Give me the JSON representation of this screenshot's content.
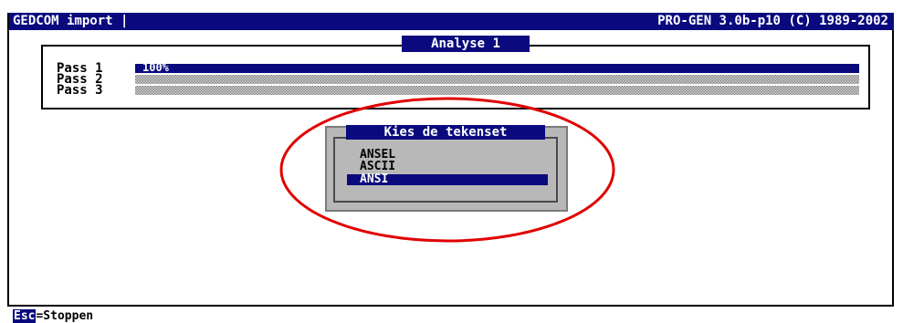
{
  "titlebar": {
    "left": "GEDCOM import |",
    "right": "PRO-GEN 3.0b-p10 (C) 1989-2002"
  },
  "analyse": {
    "title": "Analyse 1",
    "passes": [
      {
        "label": "Pass 1",
        "progress": 1.0,
        "progress_text": "100%"
      },
      {
        "label": "Pass 2",
        "progress": 0
      },
      {
        "label": "Pass 3",
        "progress": 0
      }
    ]
  },
  "dialog": {
    "title": "Kies de tekenset",
    "options": [
      "ANSEL",
      "ASCII",
      "ANSI"
    ],
    "selected": "ANSI"
  },
  "status": {
    "key": "Esc",
    "text": "=Stoppen"
  },
  "colors": {
    "titlebar_bg": "#0a0a7e",
    "dialog_bg": "#b8b8b8",
    "highlight": "#e00000"
  }
}
